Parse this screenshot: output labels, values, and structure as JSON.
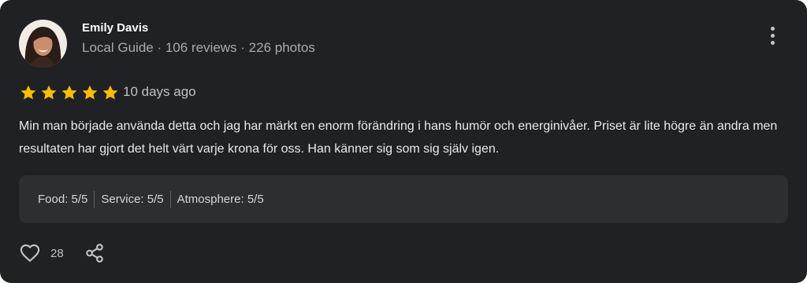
{
  "reviewer": {
    "name": "Emily Davis",
    "meta": "Local Guide · 106 reviews · 226 photos"
  },
  "rating": {
    "stars": 5,
    "max_stars": 5,
    "star_color": "#fbbc04",
    "date": "10 days ago"
  },
  "review": {
    "text": "Min man började använda detta och jag har märkt en enorm förändring i hans humör och energinivåer. Priset är lite högre än andra men resultaten har gjort det helt värt varje krona för oss. Han känner sig som sig själv igen."
  },
  "sub_ratings": [
    {
      "label": "Food: 5/5"
    },
    {
      "label": "Service: 5/5"
    },
    {
      "label": "Atmosphere: 5/5"
    }
  ],
  "actions": {
    "like_count": "28",
    "like_icon": "heart-outline-icon",
    "share_icon": "share-icon",
    "more_icon": "more-vertical-icon"
  },
  "colors": {
    "card_background": "#202124",
    "panel_background": "#2d2e31"
  }
}
